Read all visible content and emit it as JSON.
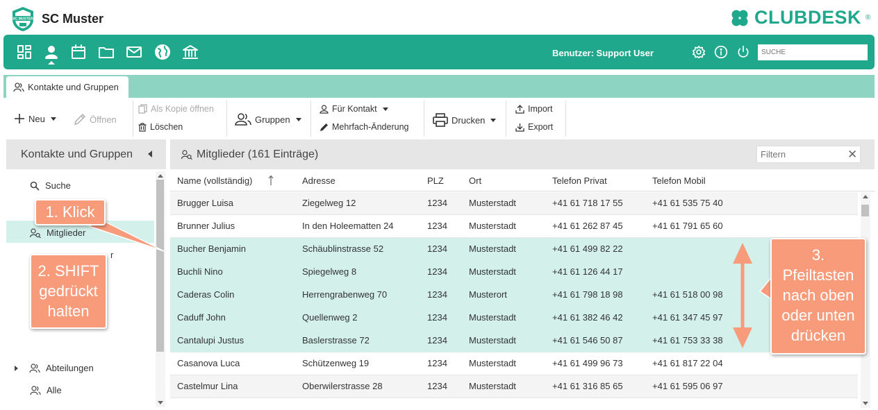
{
  "app": {
    "club_name": "SC Muster",
    "brand_name": "CLUBDESK",
    "brand_mark": "®",
    "logo_text": "SC MUSTER"
  },
  "navbar": {
    "icons": [
      "dashboard-icon",
      "person-icon",
      "calendar-icon",
      "folder-icon",
      "mail-icon",
      "globe-icon",
      "bank-icon"
    ],
    "user_label": "Benutzer: Support User",
    "right_icons": [
      "gear-icon",
      "info-icon",
      "power-icon"
    ],
    "search_placeholder": "SUCHE"
  },
  "tabs": [
    {
      "label": "Kontakte und Gruppen"
    }
  ],
  "toolbar": {
    "neu": "Neu",
    "oeffnen": "Öffnen",
    "als_kopie": "Als Kopie öffnen",
    "loeschen": "Löschen",
    "gruppen": "Gruppen",
    "fuer_kontakt": "Für Kontakt",
    "mehrfach": "Mehrfach-Änderung",
    "drucken": "Drucken",
    "import": "Import",
    "export": "Export"
  },
  "left_panel": {
    "title": "Kontakte und Gruppen",
    "nodes": [
      "Suche",
      "Mitglieder",
      "Abteilungen",
      "Alle"
    ],
    "hidden_node_tail": "r"
  },
  "main": {
    "title": "Mitglieder (161 Einträge)",
    "filter_placeholder": "Filtern",
    "columns": [
      "Name (vollständig)",
      "Adresse",
      "PLZ",
      "Ort",
      "Telefon Privat",
      "Telefon Mobil"
    ],
    "rows": [
      {
        "name": "Brugger Luisa",
        "adresse": "Ziegelweg 12",
        "plz": "1234",
        "ort": "Musterstadt",
        "privat": "+41 61 718 17 55",
        "mobil": "+41 61 535 75 40",
        "selected": false
      },
      {
        "name": "Brunner Julius",
        "adresse": "In den Holeematten 24",
        "plz": "1234",
        "ort": "Musterstadt",
        "privat": "+41 61 262 87 45",
        "mobil": "+41 61 791 65 60",
        "selected": false
      },
      {
        "name": "Bucher Benjamin",
        "adresse": "Schäublinstrasse 52",
        "plz": "1234",
        "ort": "Musterstadt",
        "privat": "+41 61 499 82 22",
        "mobil": "",
        "selected": true
      },
      {
        "name": "Buchli Nino",
        "adresse": "Spiegelweg 8",
        "plz": "1234",
        "ort": "Musterstadt",
        "privat": "+41 61 126 44 17",
        "mobil": "",
        "selected": true
      },
      {
        "name": "Caderas Colin",
        "adresse": "Herrengrabenweg 70",
        "plz": "1234",
        "ort": "Musterort",
        "privat": "+41 61 798 18 98",
        "mobil": "+41 61 518 00 98",
        "selected": true
      },
      {
        "name": "Caduff John",
        "adresse": "Quellenweg 2",
        "plz": "1234",
        "ort": "Musterstadt",
        "privat": "+41 61 382 46 42",
        "mobil": "+41 61 347 45 97",
        "selected": true
      },
      {
        "name": "Cantalupi Justus",
        "adresse": "Baslerstrasse 72",
        "plz": "1234",
        "ort": "Musterstadt",
        "privat": "+41 61 546 50 87",
        "mobil": "+41 61 753 33 38",
        "selected": true
      },
      {
        "name": "Casanova Luca",
        "adresse": "Schützenweg 19",
        "plz": "1234",
        "ort": "Musterstadt",
        "privat": "+41 61 499 96 73",
        "mobil": "+41 61 817 22 04",
        "selected": false
      },
      {
        "name": "Castelmur Lina",
        "adresse": "Oberwilerstrasse 28",
        "plz": "1234",
        "ort": "Musterstadt",
        "privat": "+41 61 316 85 65",
        "mobil": "+41 61 595 06 97",
        "selected": false
      }
    ]
  },
  "annotations": {
    "step1": "1. Klick",
    "step2_l1": "2. SHIFT",
    "step2_l2": "gedrückt",
    "step2_l3": "halten",
    "step3_l1": "3.",
    "step3_l2": "Pfeiltasten",
    "step3_l3": "nach oben",
    "step3_l4": "oder unten",
    "step3_l5": "drücken",
    "color": "#f89b7b"
  },
  "colors": {
    "accent": "#1fa88b",
    "tab_strip": "#8dd4c2",
    "selection": "#d3f0ea"
  }
}
